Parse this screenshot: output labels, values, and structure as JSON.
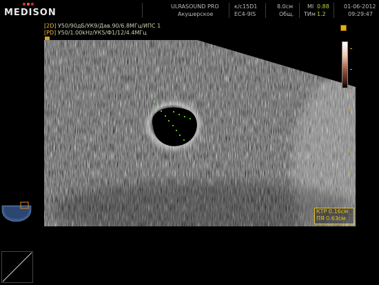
{
  "header": {
    "logo_text": "MEDISON",
    "product": "ULRASOUND PRO",
    "preset": "Акушерское",
    "probe_line1": "к/с15D1",
    "probe_line2": "EC4-9IS",
    "depth": "8.0см",
    "depth_label": "Общ.",
    "mi_label": "MI",
    "mi_value": "0.88",
    "tim_label": "TИм",
    "tim_value": "1.2",
    "date": "01-06-2012",
    "time": "09:29:47"
  },
  "info": {
    "line1_tag": "[2D]",
    "line1": "У50/90дБ/УК9/Дав.90/6.8МГц/ИПС 1",
    "line2_tag": "[PD]",
    "line2": "У50/1.00kHz/УК5/Ф1/12/4.4МГц"
  },
  "measurement": {
    "line1": "КТР  0.16см",
    "line2": "ПЯ   0.63см"
  },
  "colors": {
    "accent_yellow": "#e6c11d",
    "logo_red": "#d02a2a",
    "value_green": "#c6d43a"
  }
}
